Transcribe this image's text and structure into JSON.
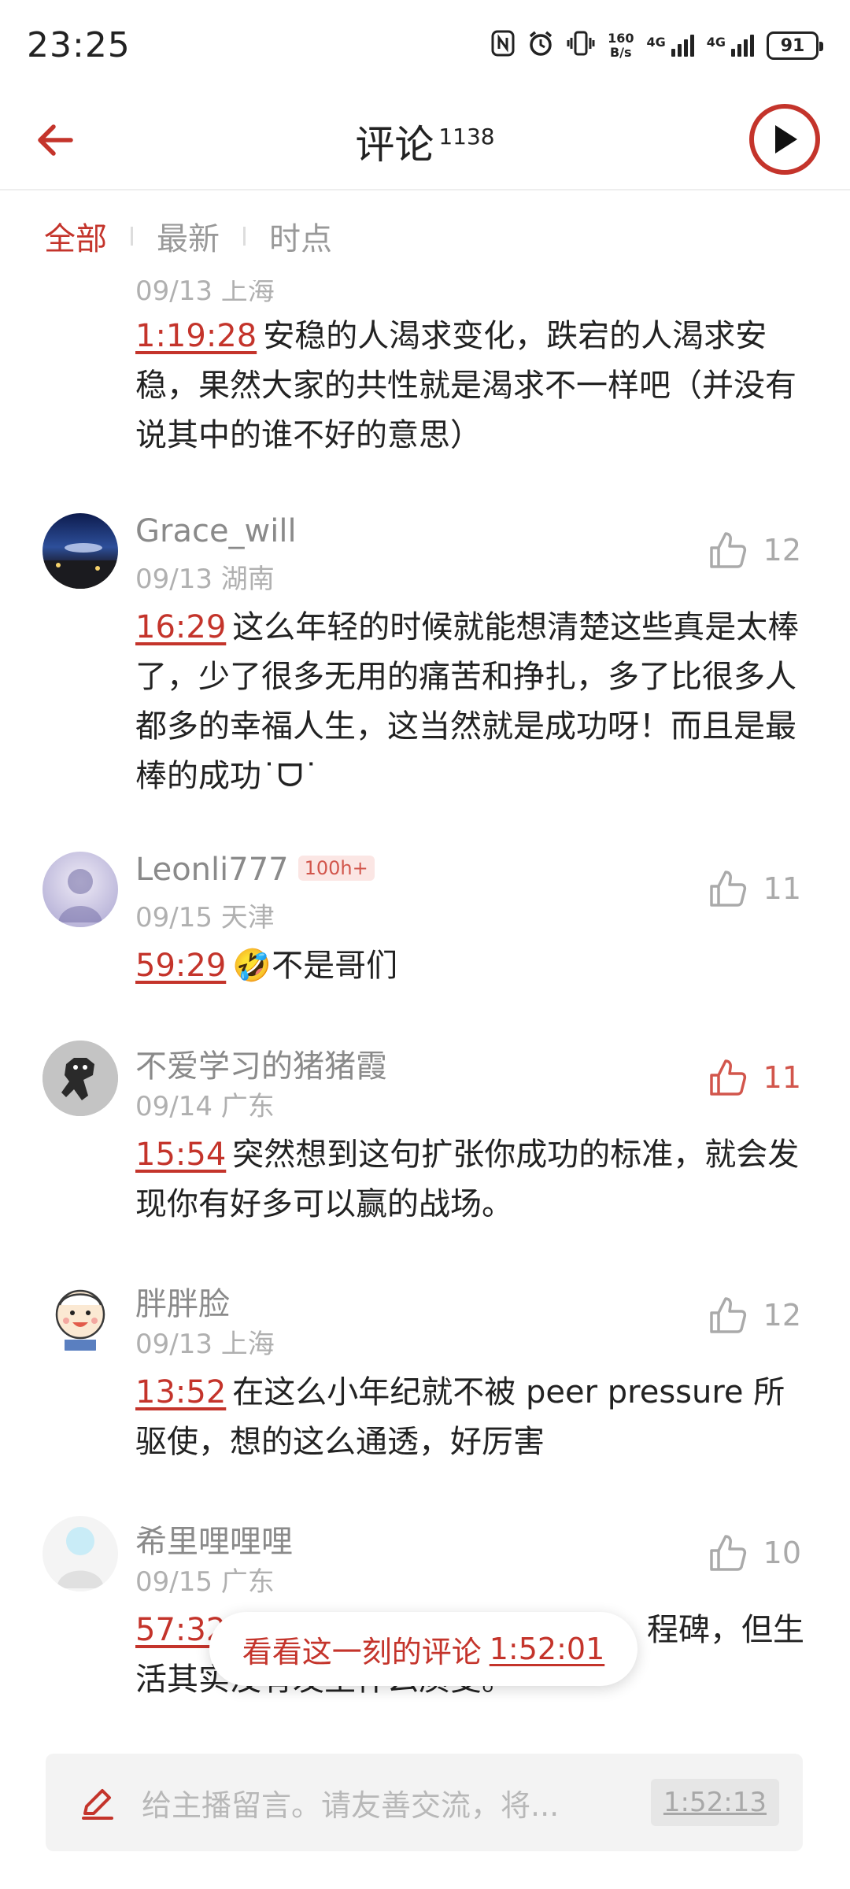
{
  "status": {
    "time": "23:25",
    "speed_top": "160",
    "speed_bottom": "B/s",
    "net1": "4G",
    "net2": "4G",
    "battery": "91"
  },
  "header": {
    "title": "评论",
    "count": "1138"
  },
  "tabs": [
    "全部",
    "最新",
    "时点"
  ],
  "comments": [
    {
      "user": "",
      "date": "09/13 上海",
      "likes": "",
      "ts": "1:19:28",
      "text": "安稳的人渴求变化，跌宕的人渴求安稳，果然大家的共性就是渴求不一样吧（并没有说其中的谁不好的意思）"
    },
    {
      "user": "Grace_will",
      "date": "09/13 湖南",
      "likes": "12",
      "ts": "16:29",
      "text": "这么年轻的时候就能想清楚这些真是太棒了，少了很多无用的痛苦和挣扎，多了比很多人都多的幸福人生，这当然就是成功呀！而且是最棒的成功˙ᗜ˙"
    },
    {
      "user": "Leonli777",
      "badge": "100h+",
      "date": "09/15 天津",
      "likes": "11",
      "ts": "59:29",
      "text": "🤣不是哥们"
    },
    {
      "user": "不爱学习的猪猪霞",
      "date": "09/14 广东",
      "likes": "11",
      "liked": true,
      "ts": "15:54",
      "text": "突然想到这句扩张你成功的标准，就会发现你有好多可以赢的战场。"
    },
    {
      "user": "胖胖脸",
      "date": "09/13 上海",
      "likes": "12",
      "ts": "13:52",
      "text": "在这么小年纪就不被 peer pressure 所驱使，想的这么通透，好厉害"
    },
    {
      "user": "希里哩哩哩",
      "date": "09/15 广东",
      "likes": "10",
      "ts": "57:32",
      "text_visible_end": "程碑，但生",
      "text_line2": "活其实没有发生什么质变。"
    }
  ],
  "pill": {
    "label": "看看这一刻的评论",
    "ts": "1:52:01"
  },
  "input": {
    "placeholder": "给主播留言。请友善交流，将...",
    "ts": "1:52:13"
  },
  "colors": {
    "accent": "#c4342b",
    "liked": "#d2564c"
  }
}
